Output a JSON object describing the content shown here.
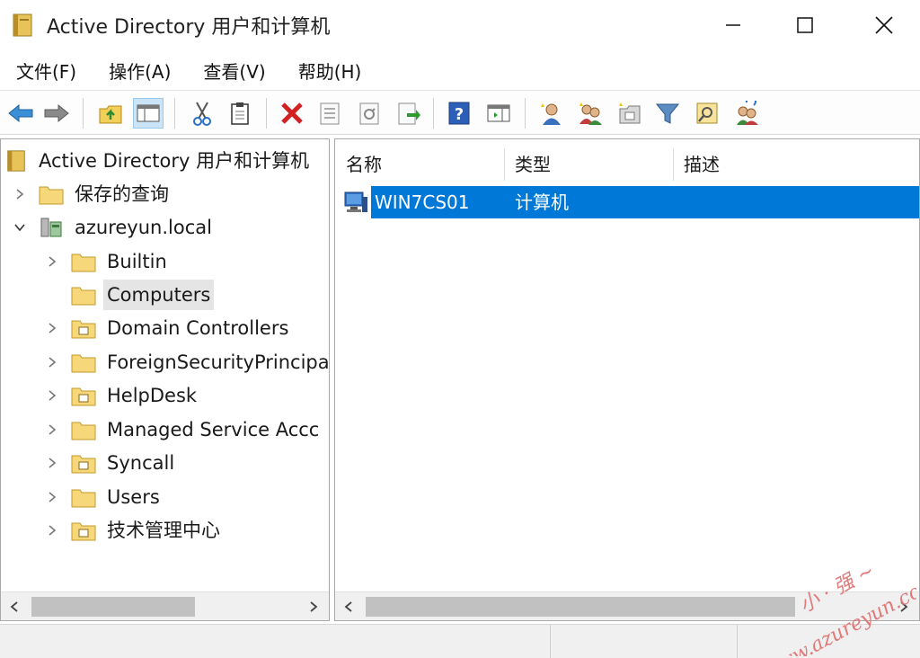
{
  "window": {
    "title": "Active Directory 用户和计算机",
    "controls": [
      "minimize",
      "maximize",
      "close"
    ]
  },
  "menu": [
    {
      "label": "文件(F)"
    },
    {
      "label": "操作(A)"
    },
    {
      "label": "查看(V)"
    },
    {
      "label": "帮助(H)"
    }
  ],
  "toolbar": {
    "buttons": [
      "back-icon",
      "forward-icon",
      "up-folder-icon",
      "show-console-tree-icon",
      "cut-icon",
      "paste-icon",
      "delete-icon",
      "properties-icon",
      "refresh-icon",
      "export-list-icon",
      "help-icon",
      "show-action-pane-icon",
      "new-user-icon",
      "new-group-icon",
      "new-ou-icon",
      "filter-icon",
      "find-icon",
      "add-to-group-icon"
    ]
  },
  "tree": {
    "root": "Active Directory 用户和计算机",
    "items": [
      {
        "label": "保存的查询",
        "expanded": false
      },
      {
        "label": "azureyun.local",
        "expanded": true
      },
      {
        "label": "Builtin"
      },
      {
        "label": "Computers",
        "selected": true
      },
      {
        "label": "Domain Controllers"
      },
      {
        "label": "ForeignSecurityPrincipa"
      },
      {
        "label": "HelpDesk"
      },
      {
        "label": "Managed Service Accc"
      },
      {
        "label": "Syncall"
      },
      {
        "label": "Users"
      },
      {
        "label": "技术管理中心"
      }
    ]
  },
  "list": {
    "columns": [
      "名称",
      "类型",
      "描述"
    ],
    "rows": [
      {
        "name": "WIN7CS01",
        "type": "计算机",
        "description": "",
        "selected": true
      }
    ]
  },
  "watermark": {
    "text_top": "小 · 强 ~",
    "text_bottom": "www.azureyun.com"
  },
  "colors": {
    "selection": "#0078d7",
    "tree_selection": "#e5e5e5",
    "toolbar_active": "#cce4f7"
  }
}
